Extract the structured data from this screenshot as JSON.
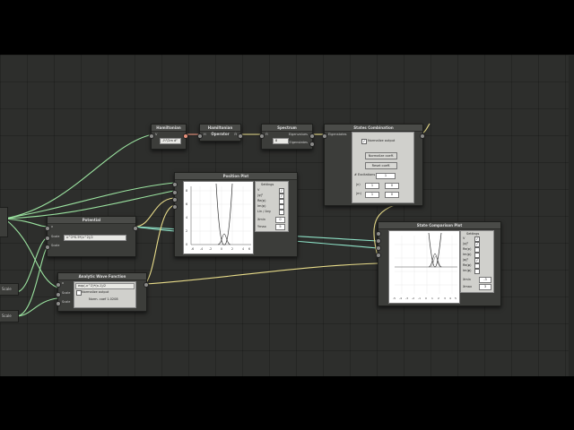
{
  "nodes": {
    "hamiltonian": {
      "title": "Hamiltonian",
      "port_in": "V",
      "field": "-ħ²/2m d²"
    },
    "operator": {
      "title": "Hamiltonian Operator",
      "port_in": "H",
      "port_out": "Ĥ"
    },
    "spectrum": {
      "title": "Spectrum",
      "port_in": "Ĥ",
      "out1": "Eigenvalues",
      "out2": "Eigenstates",
      "field": "8"
    },
    "states": {
      "title": "States Combination",
      "port_in": "Eigenstates",
      "normalize_label": "Normalize output",
      "normalize_coeff": "Normalize coeff.",
      "reset_coeff": "Reset coeff.",
      "excitations_label": "# Excitations",
      "excitations_value": "1",
      "rows": [
        {
          "label": "|n⟩",
          "a": "1",
          "b": "0"
        },
        {
          "label": "|m⟩",
          "a": "1",
          "b": "0"
        }
      ]
    },
    "position_plot": {
      "title": "Position Plot",
      "settings_title": "Settings",
      "checks": [
        {
          "label": "V",
          "checked": true
        },
        {
          "label": "|ψ|²",
          "checked": true
        },
        {
          "label": "Re(ψ)",
          "checked": false
        },
        {
          "label": "Im(ψ)",
          "checked": false
        },
        {
          "label": "Lin / Arg",
          "checked": false
        }
      ],
      "xmin_label": "Xmin",
      "xmin_value": "0",
      "xmax_label": "Ymax",
      "xmax_value": "5",
      "yticks": [
        "8",
        "6",
        "4",
        "2",
        "0"
      ],
      "xticks": [
        "-6",
        "-4",
        "-2",
        "0",
        "2",
        "4",
        "6"
      ]
    },
    "potential": {
      "title": "Potential",
      "ports": [
        "x",
        "Scale",
        "Scale"
      ],
      "formula": "x^2*0.5*(x^2)/2"
    },
    "analytic": {
      "title": "Analytic Wave Function",
      "ports": [
        "x",
        "Scale",
        "Scale"
      ],
      "formula": "exp(-x^2)*(x-1)/2",
      "normalize_label": "Normalize output",
      "norm_text": "Norm. coef 1.0208"
    },
    "state_comparison": {
      "title": "State Comparison Plot",
      "settings_title": "Settings",
      "checks": [
        {
          "label": "V",
          "checked": true
        },
        {
          "label": "|ψ|²",
          "checked": true
        },
        {
          "label": "Re(ψ)",
          "checked": false
        },
        {
          "label": "Im(ψ)",
          "checked": false
        },
        {
          "label": "|φ|²",
          "checked": true
        },
        {
          "label": "Re(φ)",
          "checked": false
        },
        {
          "label": "Im(φ)",
          "checked": false
        }
      ],
      "xmin_label": "Xmin",
      "xmin_value": "-3",
      "xmax_label": "Xmax",
      "xmax_value": "3",
      "xticks": [
        "-5",
        "-4",
        "-3",
        "-2",
        "-1",
        "0",
        "1",
        "2",
        "3",
        "4",
        "5"
      ]
    },
    "side_scale_1": {
      "label": "Scale"
    },
    "side_scale_2": {
      "label": "Scale"
    }
  },
  "colors": {
    "wire_green": "#9be3a0",
    "wire_yellow": "#e8dc8a",
    "wire_teal": "#8fe3c8",
    "canvas_bg": "#2d2e2c"
  }
}
